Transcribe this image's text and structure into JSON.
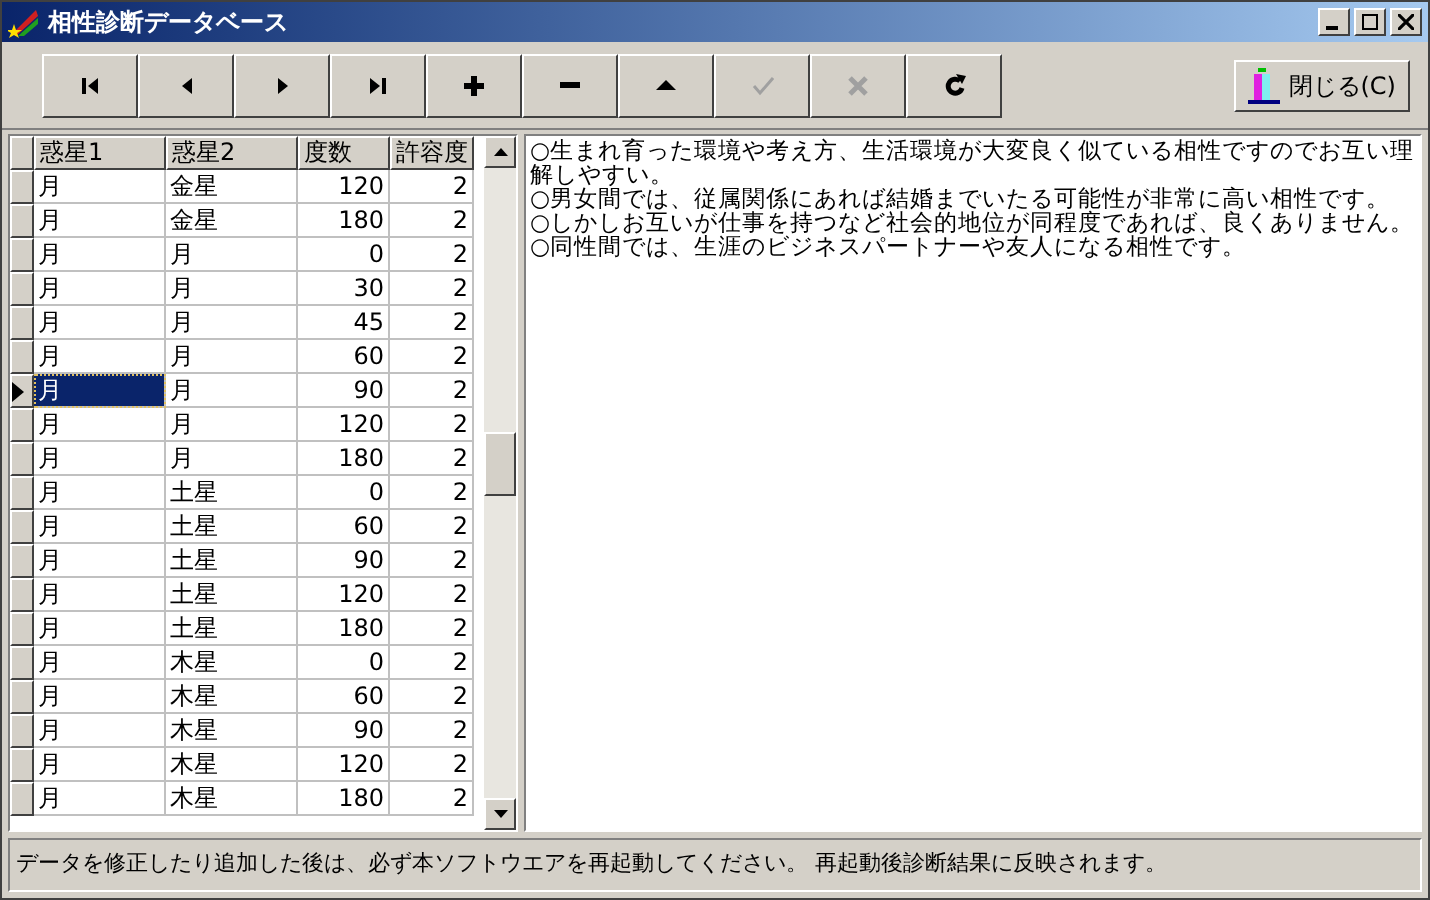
{
  "window": {
    "title": "相性診断データベース"
  },
  "toolbar": [
    {
      "kind": "first",
      "disabled": false
    },
    {
      "kind": "prior",
      "disabled": false
    },
    {
      "kind": "next",
      "disabled": false
    },
    {
      "kind": "last",
      "disabled": false
    },
    {
      "kind": "insert",
      "disabled": false
    },
    {
      "kind": "delete",
      "disabled": false
    },
    {
      "kind": "edit",
      "disabled": false
    },
    {
      "kind": "post",
      "disabled": true
    },
    {
      "kind": "cancel",
      "disabled": true
    },
    {
      "kind": "refresh",
      "disabled": false
    }
  ],
  "close_button": {
    "label": "閉じる(C)"
  },
  "table": {
    "columns": [
      "惑星1",
      "惑星2",
      "度数",
      "許容度"
    ],
    "rows": [
      {
        "cells": [
          "月",
          "金星",
          "120",
          "2"
        ],
        "selected": false
      },
      {
        "cells": [
          "月",
          "金星",
          "180",
          "2"
        ],
        "selected": false
      },
      {
        "cells": [
          "月",
          "月",
          "0",
          "2"
        ],
        "selected": false
      },
      {
        "cells": [
          "月",
          "月",
          "30",
          "2"
        ],
        "selected": false
      },
      {
        "cells": [
          "月",
          "月",
          "45",
          "2"
        ],
        "selected": false
      },
      {
        "cells": [
          "月",
          "月",
          "60",
          "2"
        ],
        "selected": false
      },
      {
        "cells": [
          "月",
          "月",
          "90",
          "2"
        ],
        "selected": true
      },
      {
        "cells": [
          "月",
          "月",
          "120",
          "2"
        ],
        "selected": false
      },
      {
        "cells": [
          "月",
          "月",
          "180",
          "2"
        ],
        "selected": false
      },
      {
        "cells": [
          "月",
          "土星",
          "0",
          "2"
        ],
        "selected": false
      },
      {
        "cells": [
          "月",
          "土星",
          "60",
          "2"
        ],
        "selected": false
      },
      {
        "cells": [
          "月",
          "土星",
          "90",
          "2"
        ],
        "selected": false
      },
      {
        "cells": [
          "月",
          "土星",
          "120",
          "2"
        ],
        "selected": false
      },
      {
        "cells": [
          "月",
          "土星",
          "180",
          "2"
        ],
        "selected": false
      },
      {
        "cells": [
          "月",
          "木星",
          "0",
          "2"
        ],
        "selected": false
      },
      {
        "cells": [
          "月",
          "木星",
          "60",
          "2"
        ],
        "selected": false
      },
      {
        "cells": [
          "月",
          "木星",
          "90",
          "2"
        ],
        "selected": false
      },
      {
        "cells": [
          "月",
          "木星",
          "120",
          "2"
        ],
        "selected": false
      },
      {
        "cells": [
          "月",
          "木星",
          "180",
          "2"
        ],
        "selected": false
      }
    ]
  },
  "memo": [
    "○生まれ育った環境や考え方、生活環境が大変良く似ている相性ですのでお互い理解しやすい。",
    "○男女間では、従属関係にあれば結婚までいたる可能性が非常に高い相性です。",
    "○しかしお互いが仕事を持つなど社会的地位が同程度であれば、良くありません。",
    "○同性間では、生涯のビジネスパートナーや友人になる相性です。"
  ],
  "status_bar": "データを修正したり追加した後は、必ず本ソフトウエアを再起動してください。 再起動後診断結果に反映されます。"
}
